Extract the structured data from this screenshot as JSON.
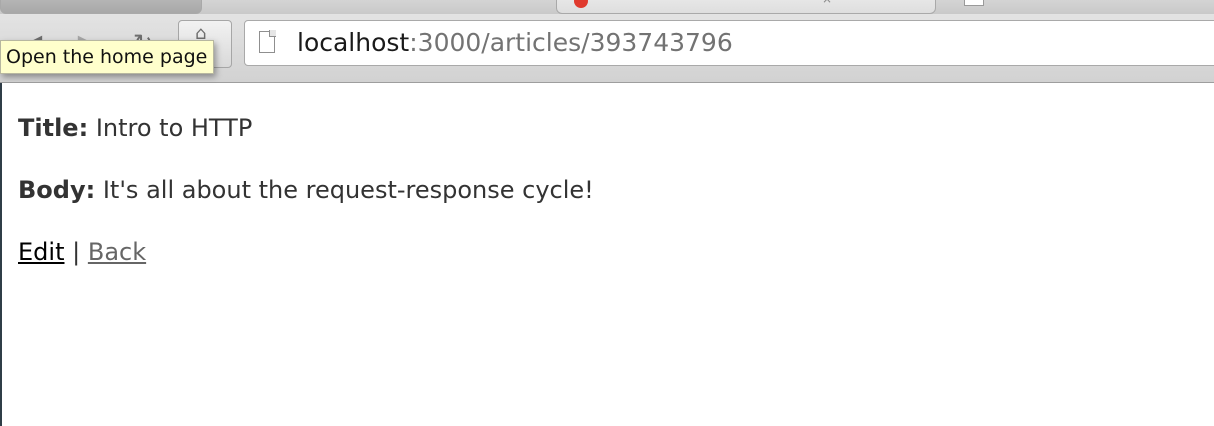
{
  "browser": {
    "address_bar": {
      "host": "localhost",
      "path": ":3000/articles/393743796"
    },
    "home_tooltip": "Open the home page",
    "icons": {
      "back": "back-arrow-icon",
      "forward": "forward-arrow-icon",
      "reload": "reload-icon",
      "home": "home-icon",
      "page": "page-icon"
    }
  },
  "article": {
    "title_label": "Title:",
    "title_value": "Intro to HTTP",
    "body_label": "Body:",
    "body_value": "It's all about the request-response cycle!"
  },
  "links": {
    "edit": "Edit",
    "separator": "|",
    "back": "Back"
  },
  "colors": {
    "tooltip_bg": "#ffffcc",
    "edit_link": "#000000",
    "back_link": "#666666",
    "text": "#333333"
  }
}
